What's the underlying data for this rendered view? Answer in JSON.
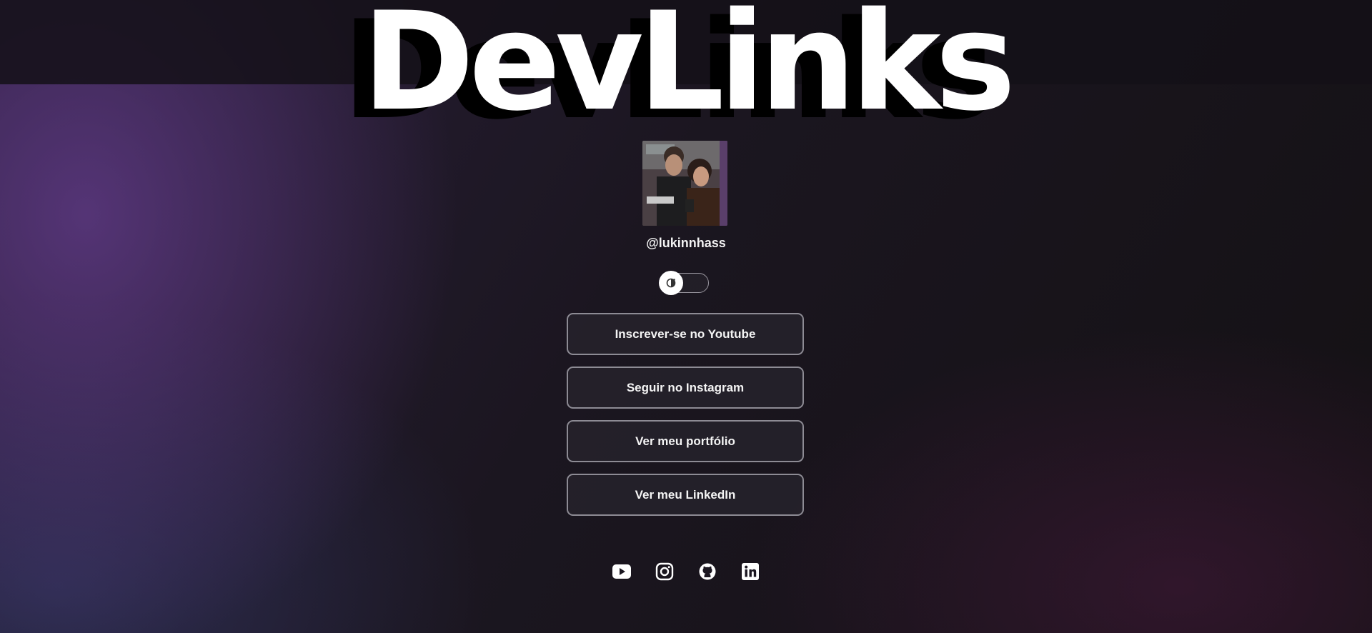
{
  "brand": {
    "title": "DevLinks"
  },
  "profile": {
    "handle": "@lukinnhass",
    "avatar_alt": "profile photo"
  },
  "theme_toggle": {
    "state": "off",
    "icon": "theme-switch-icon"
  },
  "links": [
    {
      "label": "Inscrever-se no Youtube"
    },
    {
      "label": "Seguir no Instagram"
    },
    {
      "label": "Ver meu portfólio"
    },
    {
      "label": "Ver meu LinkedIn"
    }
  ],
  "social_icons": [
    "youtube-icon",
    "instagram-icon",
    "github-icon",
    "linkedin-icon"
  ],
  "colors": {
    "accent_purple": "#643c8c",
    "button_border": "#8d8b94",
    "background_dark": "#141114"
  }
}
